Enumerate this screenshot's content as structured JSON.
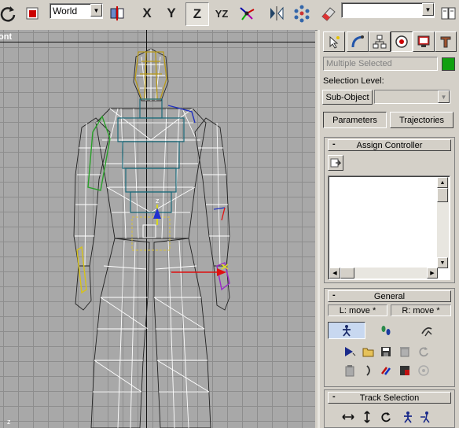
{
  "toolbar": {
    "coord_system": "World",
    "axis_x": "X",
    "axis_y": "Y",
    "axis_z": "Z",
    "axis_yz": "YZ",
    "named_selection": ""
  },
  "viewport": {
    "label": "ont",
    "axis_indicator": "z"
  },
  "motion_panel": {
    "selection_name": "Multiple Selected",
    "selection_color": "#10a010",
    "selection_level_label": "Selection Level:",
    "sub_object_button": "Sub-Object",
    "sub_object_value": "",
    "parameters_button": "Parameters",
    "trajectories_button": "Trajectories",
    "assign_controller_title": "Assign Controller",
    "general_title": "General",
    "l_move_label": "L: move *",
    "r_move_label": "R: move *",
    "track_selection_title": "Track Selection",
    "minus": "-"
  },
  "colors": {
    "ui_face": "#d4d0c8",
    "viewport_bg": "#a8a8a8",
    "grid_line": "#8d8d8d"
  }
}
